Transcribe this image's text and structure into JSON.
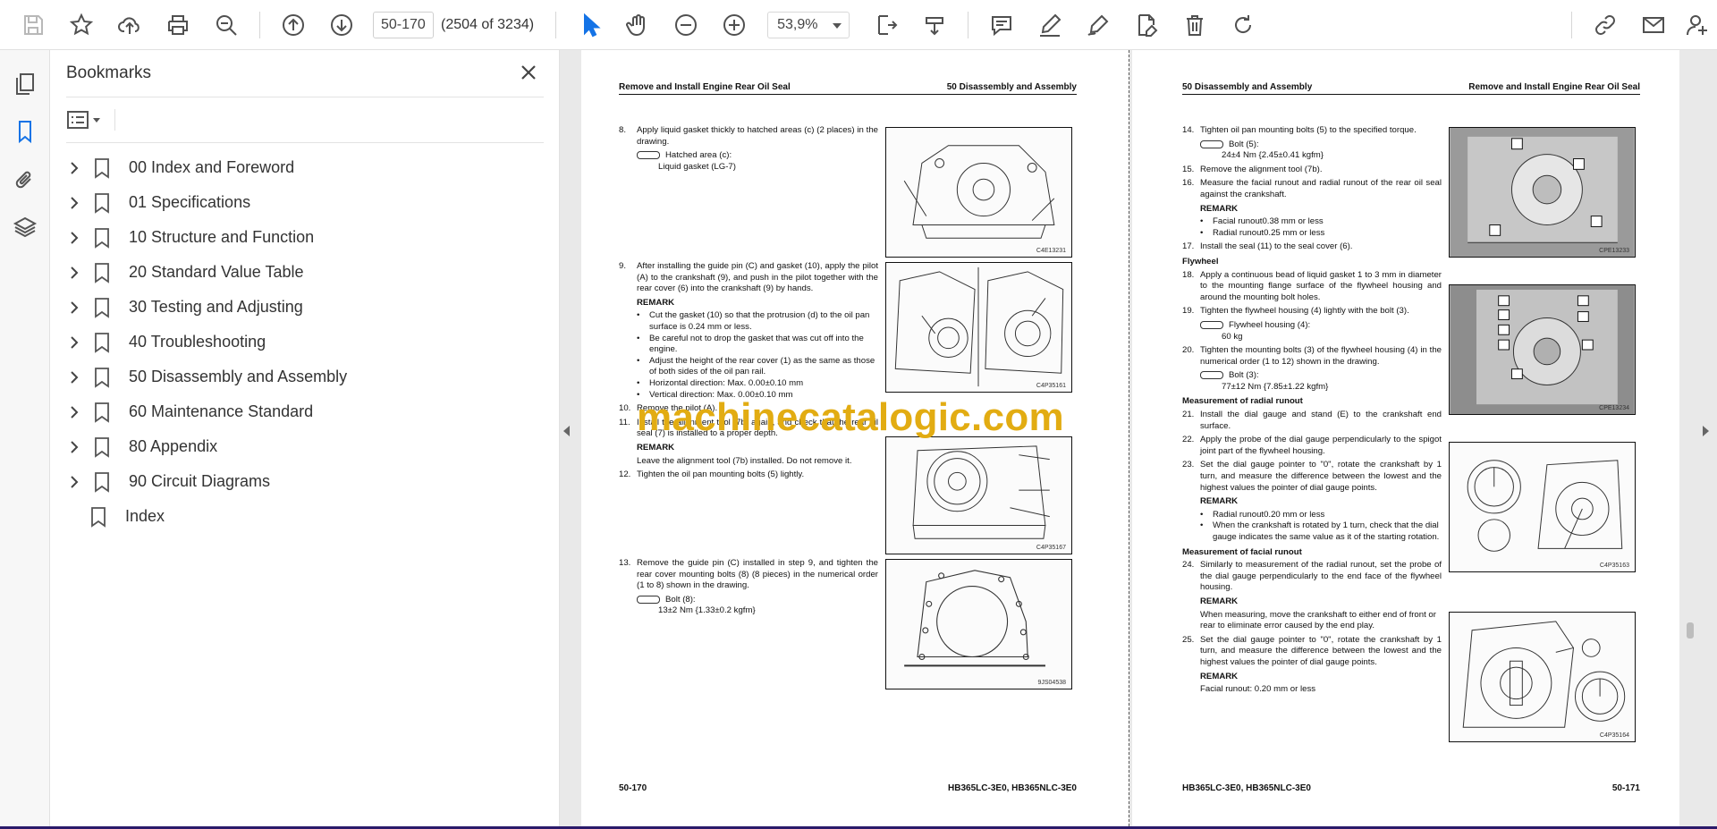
{
  "toolbar": {
    "page_input": "50-170",
    "page_count": "(2504 of 3234)",
    "zoom": "53,9%"
  },
  "bookmarks": {
    "title": "Bookmarks",
    "items": [
      {
        "label": "00 Index and Foreword"
      },
      {
        "label": "01 Specifications"
      },
      {
        "label": "10 Structure and Function"
      },
      {
        "label": "20 Standard Value Table"
      },
      {
        "label": "30 Testing and Adjusting"
      },
      {
        "label": "40 Troubleshooting"
      },
      {
        "label": "50 Disassembly and Assembly"
      },
      {
        "label": "60 Maintenance Standard"
      },
      {
        "label": "80 Appendix"
      },
      {
        "label": "90 Circuit Diagrams"
      },
      {
        "label": "Index"
      }
    ]
  },
  "left_page": {
    "header_left": "Remove and Install Engine Rear Oil Seal",
    "header_right": "50 Disassembly and Assembly",
    "footer_left": "50-170",
    "footer_right": "HB365LC-3E0, HB365NLC-3E0",
    "s8_num": "8.",
    "s8_text": "Apply liquid gasket thickly to hatched areas (c) (2 places) in the drawing.",
    "s8_sub1": "Hatched area (c):",
    "s8_sub2": "Liquid gasket (LG-7)",
    "s9_num": "9.",
    "s9_text": "After installing the guide pin (C) and gasket (10), apply the pilot (A) to the crankshaft (9), and push in the pilot together with the rear cover (6) into the crankshaft (9) by hands.",
    "remark": "REMARK",
    "s9_b1": "Cut the gasket (10) so that the protrusion (d) to the oil pan surface is 0.24 mm or less.",
    "s9_b2": "Be careful not to drop the gasket that was cut off into the engine.",
    "s9_b3": "Adjust the height of the rear cover (1) as the same as those of both sides of the oil pan rail.",
    "s9_b4": "Horizontal direction: Max. 0.00±0.10 mm",
    "s9_b5": "Vertical direction: Max. 0.00±0.10 mm",
    "s10_num": "10.",
    "s10_text": "Remove the pilot (A).",
    "s11_num": "11.",
    "s11_text": "Install the alignment tool (7b) again, and check that the rear oil seal (7) is installed to a proper depth.",
    "s11_remark_text": "Leave the alignment tool (7b) installed. Do not remove it.",
    "s12_num": "12.",
    "s12_text": "Tighten the oil pan mounting bolts (5) lightly.",
    "s13_num": "13.",
    "s13_text": "Remove the guide pin (C) installed in step 9, and tighten the rear cover mounting bolts (8) (8 pieces) in the numerical order (1 to 8) shown in the drawing.",
    "s13_sub1": "Bolt (8):",
    "s13_sub2": "13±2 Nm {1.33±0.2 kgfm}",
    "fig1_code": "C4E13231",
    "fig2_code": "C4P35161",
    "fig3_code": "C4P35167",
    "fig4_code": "9JS04538"
  },
  "right_page": {
    "header_left": "50 Disassembly and Assembly",
    "header_right": "Remove and Install Engine Rear Oil Seal",
    "footer_left": "HB365LC-3E0, HB365NLC-3E0",
    "footer_right": "50-171",
    "s14_num": "14.",
    "s14_text": "Tighten oil pan mounting bolts (5) to the specified torque.",
    "s14_sub1": "Bolt (5):",
    "s14_sub2": "24±4 Nm {2.45±0.41 kgfm}",
    "s15_num": "15.",
    "s15_text": "Remove the alignment tool (7b).",
    "s16_num": "16.",
    "s16_text": "Measure the facial runout and radial runout of the rear oil seal against the crankshaft.",
    "remark": "REMARK",
    "s16_b1": "Facial runout0.38 mm or less",
    "s16_b2": "Radial runout0.25 mm or less",
    "s17_num": "17.",
    "s17_text": "Install the seal (11) to the seal cover (6).",
    "flywheel": "Flywheel",
    "s18_num": "18.",
    "s18_text": "Apply a continuous bead of liquid gasket 1 to 3 mm in diameter to the mounting flange surface of the flywheel housing and around the mounting bolt holes.",
    "s19_num": "19.",
    "s19_text": "Tighten the flywheel housing (4) lightly with the bolt (3).",
    "s19_sub1": "Flywheel housing (4):",
    "s19_sub2": "60 kg",
    "s20_num": "20.",
    "s20_text": "Tighten the mounting bolts (3) of the flywheel housing (4) in the numerical order (1 to 12) shown in the drawing.",
    "s20_sub1": "Bolt (3):",
    "s20_sub2": "77±12 Nm {7.85±1.22 kgfm}",
    "radial_head": "Measurement of radial runout",
    "s21_num": "21.",
    "s21_text": "Install the dial gauge and stand (E) to the crankshaft end surface.",
    "s22_num": "22.",
    "s22_text": "Apply the probe of the dial gauge perpendicularly to the spigot joint part of the flywheel housing.",
    "s23_num": "23.",
    "s23_text": "Set the dial gauge pointer to \"0\", rotate the crankshaft by 1 turn, and measure the difference between the lowest and the highest values the pointer of dial gauge points.",
    "s23_b1": "Radial runout0.20 mm or less",
    "s23_b2": "When the crankshaft is rotated by 1 turn, check that the dial gauge indicates the same value as it of the starting rotation.",
    "facial_head": "Measurement of facial runout",
    "s24_num": "24.",
    "s24_text": "Similarly to measurement of the radial runout, set the probe of the dial gauge perpendicularly to the end face of the flywheel housing.",
    "s24_remark_text": "When measuring, move the crankshaft to either end of front or rear to eliminate error caused by the end play.",
    "s25_num": "25.",
    "s25_text": "Set the dial gauge pointer to \"0\", rotate the crankshaft by 1 turn, and measure the difference between the lowest and the highest values the pointer of dial gauge points.",
    "s25_remark_text": "Facial runout: 0.20 mm or less",
    "fig1_code": "CPE13233",
    "fig2_code": "CPE13234",
    "fig3_code": "C4P35163",
    "fig4_code": "C4P35164"
  },
  "watermark": "machinecatalogic.com",
  "colors": {
    "accent": "#1473e6",
    "watermark": "#e2ac12"
  }
}
